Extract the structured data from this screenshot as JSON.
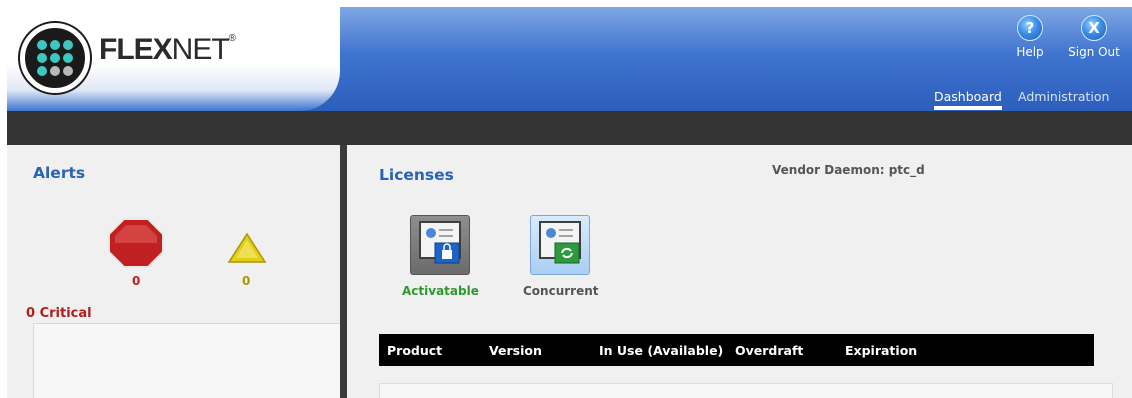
{
  "brand": {
    "name_bold": "FLEX",
    "name_light": "NET",
    "mark": "®"
  },
  "header": {
    "help_label": "Help",
    "signout_label": "Sign Out",
    "help_icon_glyph": "?",
    "signout_icon_glyph": "X",
    "tabs": [
      {
        "label": "Dashboard",
        "active": true
      },
      {
        "label": "Administration",
        "active": false
      }
    ]
  },
  "alerts": {
    "title": "Alerts",
    "critical_count": "0",
    "warning_count": "0",
    "critical_summary": "0 Critical",
    "colors": {
      "critical": "#c0201f",
      "warning": "#b9a800"
    }
  },
  "licenses": {
    "title": "Licenses",
    "vendor_daemon": "Vendor Daemon: ptc_d",
    "types": [
      {
        "label": "Activatable",
        "icon": "certificate-lock-icon",
        "color": "#2c9a2c"
      },
      {
        "label": "Concurrent",
        "icon": "certificate-sync-icon",
        "color": "#555555"
      }
    ],
    "table_columns": [
      "Product",
      "Version",
      "In Use (Available)",
      "Overdraft",
      "Expiration"
    ]
  },
  "colors": {
    "header_blue": "#3f74cf",
    "title_blue": "#2a62b5",
    "dark_bar": "#333333"
  }
}
